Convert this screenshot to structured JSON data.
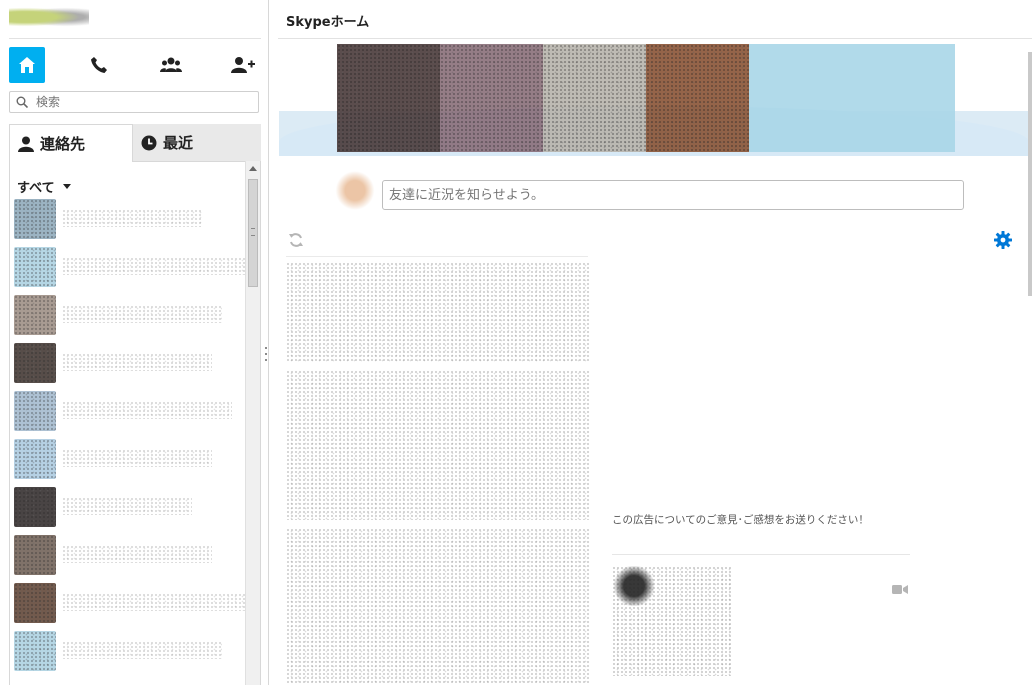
{
  "sidebar": {
    "nav": {
      "home_icon": "home-icon",
      "call_icon": "phone-icon",
      "group_icon": "group-icon",
      "add_contact_icon": "add-contact-icon",
      "active_color": "#00aff0"
    },
    "search": {
      "placeholder": "検索"
    },
    "tabs": [
      {
        "label": "連絡先",
        "icon": "person-icon",
        "active": true
      },
      {
        "label": "最近",
        "icon": "clock-icon",
        "active": false
      }
    ],
    "filter_label": "すべて"
  },
  "main": {
    "title": "Skypeホーム",
    "status_placeholder": "友達に近況を知らせよう。",
    "ad_feedback_text": "この広告についてのご意見･ご感想をお送りください！",
    "accent_color": "#0078d7"
  }
}
